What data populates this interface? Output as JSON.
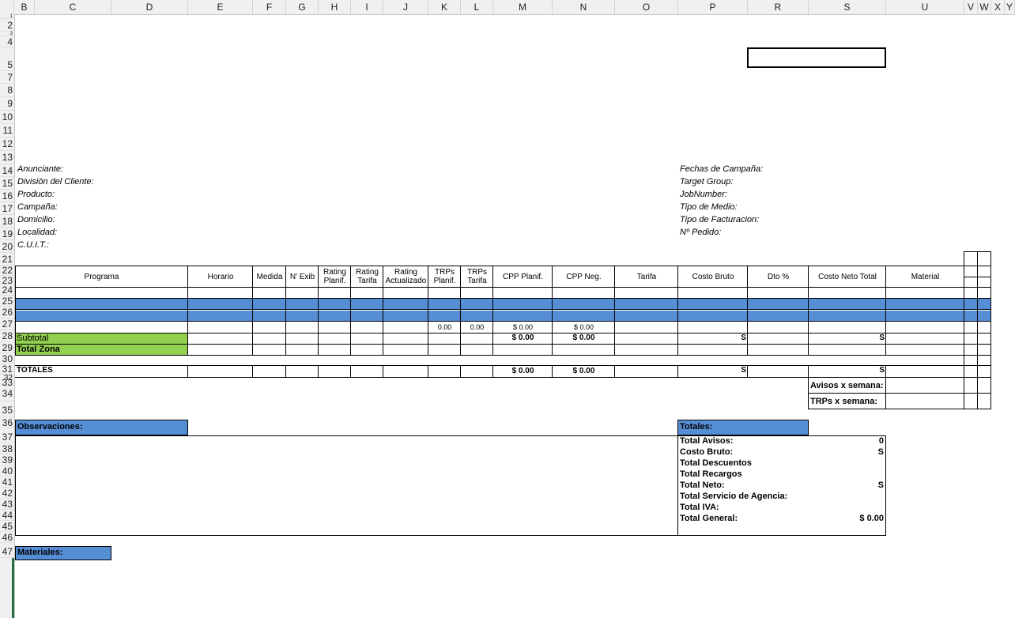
{
  "columns": [
    "B",
    "C",
    "D",
    "E",
    "F",
    "G",
    "H",
    "I",
    "J",
    "K",
    "L",
    "M",
    "N",
    "O",
    "P",
    "R",
    "S",
    "U",
    "V",
    "W",
    "X",
    "Y"
  ],
  "rows": [
    "1",
    "2",
    "3",
    "4",
    "5",
    "7",
    "8",
    "9",
    "10",
    "11",
    "12",
    "13",
    "14",
    "15",
    "16",
    "17",
    "18",
    "19",
    "20",
    "21",
    "22",
    "23",
    "24",
    "25",
    "26",
    "27",
    "28",
    "29",
    "30",
    "31",
    "32",
    "33",
    "34",
    "35",
    "36",
    "37",
    "38",
    "39",
    "40",
    "41",
    "42",
    "43",
    "44",
    "45",
    "46",
    "47"
  ],
  "client_info": {
    "left": [
      "Anunciante:",
      "División del Cliente:",
      "Producto:",
      "Campaña:",
      "Domicilio:",
      "Localidad:",
      "C.U.I.T.:"
    ],
    "right": [
      "Fechas de Campaña:",
      "Target Group:",
      "JobNumber:",
      "Tipo de Medio:",
      "Tipo de Facturacion:",
      "Nº Pedido:"
    ]
  },
  "table": {
    "headers": [
      "Programa",
      "Horario",
      "Medida",
      "N' Exib",
      "Rating Planif.",
      "Rating Tarifa",
      "Rating Actualizado",
      "TRPs Planif.",
      "TRPs Tarifa",
      "CPP Planif.",
      "CPP Neg.",
      "Tarifa",
      "Costo Bruto",
      "Dto %",
      "Costo Neto Total",
      "Material"
    ],
    "row27": {
      "trps_planif": "0.00",
      "trps_tarifa": "0.00",
      "cpp_planif": "$ 0.00",
      "cpp_neg": "$ 0.00"
    },
    "subtotal": {
      "label": "Subtotal",
      "cpp_planif": "$ 0.00",
      "cpp_neg": "$ 0.00",
      "costo_bruto": "S",
      "costo_neto": "S"
    },
    "total_zona": "Total Zona",
    "totales": {
      "label": "TOTALES",
      "cpp_planif": "$ 0.00",
      "cpp_neg": "$ 0.00",
      "costo_bruto": "S",
      "costo_neto": "S"
    },
    "avisos_semana": "Avisos x semana:",
    "trps_semana": "TRPs x semana:"
  },
  "observaciones": "Observaciones:",
  "materiales": "Materiales:",
  "totales_box": {
    "title": "Totales:",
    "items": [
      {
        "label": "Total Avisos:",
        "value": "0"
      },
      {
        "label": "Costo Bruto:",
        "value": "S"
      },
      {
        "label": "Total Descuentos",
        "value": ""
      },
      {
        "label": "Total Recargos",
        "value": ""
      },
      {
        "label": "Total Neto:",
        "value": "S"
      },
      {
        "label": "Total Servicio de Agencia:",
        "value": ""
      },
      {
        "label": "Total IVA:",
        "value": ""
      },
      {
        "label": "Total General:",
        "value": "$ 0.00"
      }
    ]
  },
  "colors": {
    "blue": "#558ed5",
    "green": "#92d050",
    "grid_select": "#217346"
  }
}
